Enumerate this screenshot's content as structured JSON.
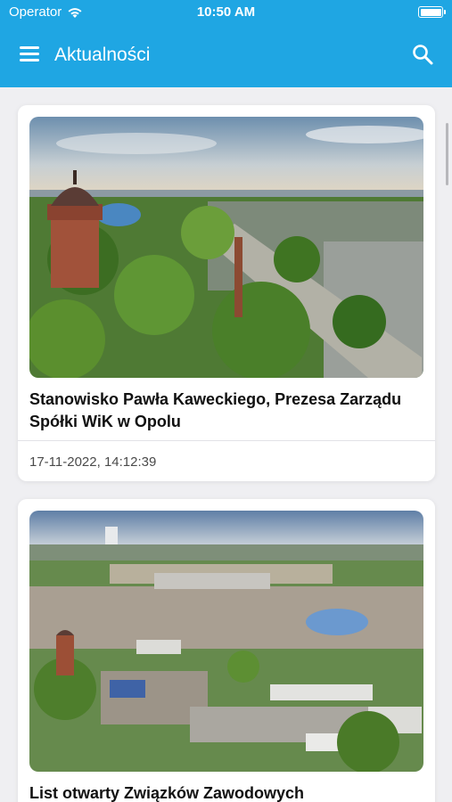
{
  "status_bar": {
    "carrier": "Operator",
    "time": "10:50 AM"
  },
  "header": {
    "title": "Aktualności",
    "menu_icon": "hamburger-menu-icon",
    "search_icon": "search-icon"
  },
  "colors": {
    "primary": "#1fa6e3",
    "background": "#efeff2"
  },
  "articles": [
    {
      "title": "Stanowisko Pawła Kaweckiego, Prezesa Zarządu Spółki WiK w Opolu",
      "date": "17-11-2022, 14:12:39"
    },
    {
      "title": "List otwarty Związków Zawodowych",
      "date": ""
    }
  ]
}
